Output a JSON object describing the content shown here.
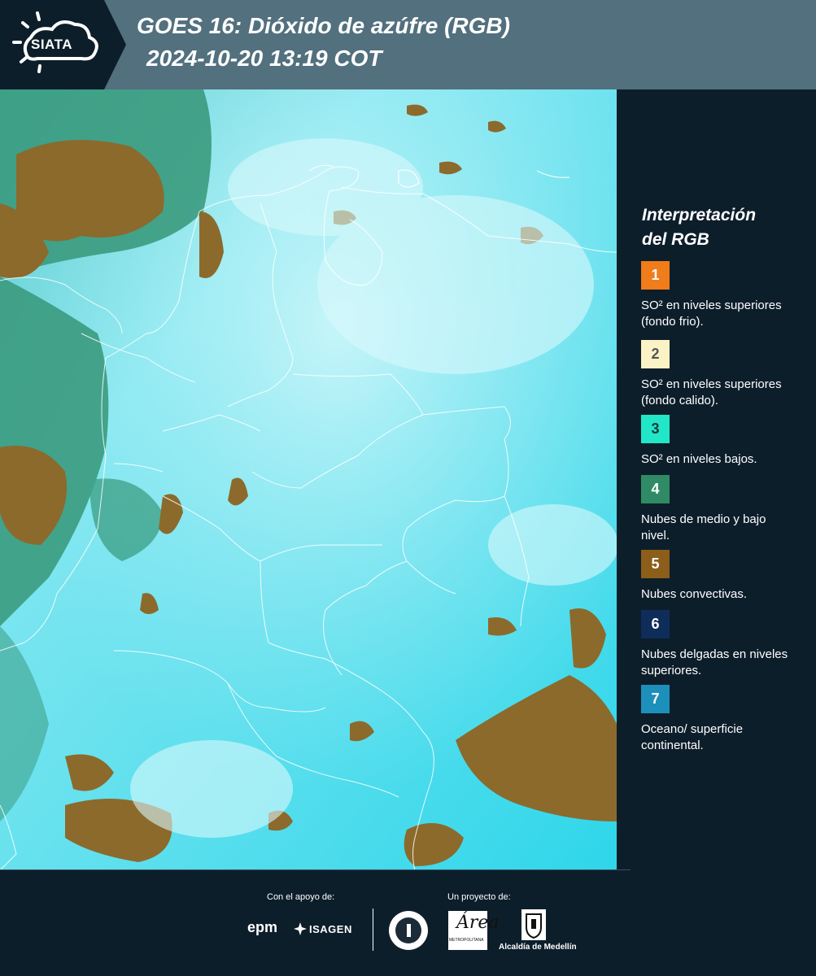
{
  "header": {
    "logo_label": "SIATA",
    "title_line1": "GOES 16: Dióxido de azúfre (RGB)",
    "title_line2": "2024-10-20 13:19 COT",
    "background_color": "#52707e",
    "logo_background_color": "#0d1e2b"
  },
  "map": {
    "description_icon": "satellite-map-image",
    "base_color": "#3fdcec",
    "cloud_colors": [
      "#8b6a2c",
      "#2d8f77",
      "#c8f4f8"
    ]
  },
  "legend": {
    "title_line1": "Interpretación",
    "title_line2": "del RGB",
    "items": [
      {
        "number": "1",
        "color": "#f07c1a",
        "text_color": "#ffffff",
        "label": "SO² en niveles superiores (fondo frio)."
      },
      {
        "number": "2",
        "color": "#fbf3c6",
        "text_color": "#555555",
        "label": "SO² en niveles superiores (fondo calido)."
      },
      {
        "number": "3",
        "color": "#22e6c8",
        "text_color": "#1a3a3a",
        "label": "SO² en niveles bajos."
      },
      {
        "number": "4",
        "color": "#2e8b66",
        "text_color": "#ffffff",
        "label": "Nubes de medio y bajo nivel."
      },
      {
        "number": "5",
        "color": "#8b5e1a",
        "text_color": "#ffffff",
        "label": "Nubes convectivas."
      },
      {
        "number": "6",
        "color": "#0e2d5a",
        "text_color": "#ffffff",
        "label": "Nubes delgadas en niveles superiores."
      },
      {
        "number": "7",
        "color": "#1d8fbb",
        "text_color": "#ffffff",
        "label": "Oceano/ superficie continental."
      }
    ]
  },
  "footer": {
    "support_label": "Con el apoyo de:",
    "project_label": "Un proyecto de:",
    "epm_label": "epm",
    "isagen_label": "ISAGEN",
    "amva_logo_big": "Área",
    "amva_logo_small": "METROPOLITANA",
    "alcaldia_label": "Alcaldía de Medellín"
  }
}
